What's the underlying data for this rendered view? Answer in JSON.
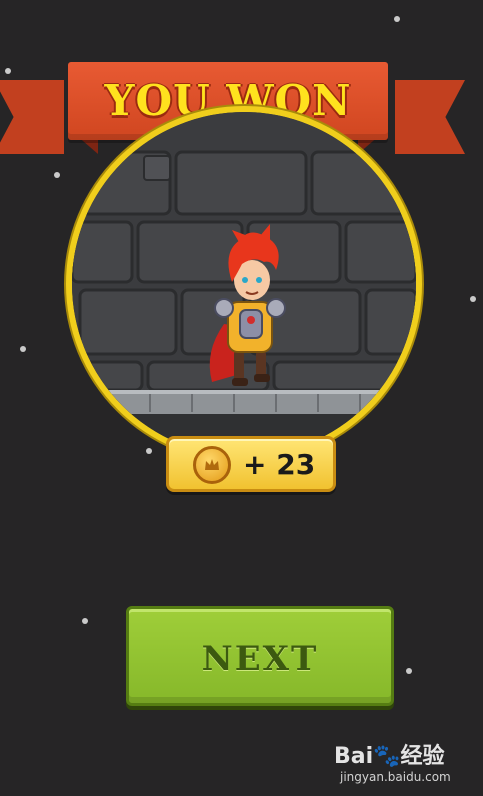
{
  "banner": {
    "title": "YOU WON"
  },
  "reward": {
    "amount_text": "+ 23",
    "icon": "coin-icon"
  },
  "actions": {
    "next_label": "NEXT"
  },
  "watermark": {
    "brand": "Bai🐾经验",
    "site": "jingyan.baidu.com"
  },
  "colors": {
    "background": "#262526",
    "ribbon": "#d04620",
    "title": "#ffe21e",
    "frame": "#f0ce1c",
    "button": "#8fc131",
    "button_text": "#3c5a10"
  }
}
